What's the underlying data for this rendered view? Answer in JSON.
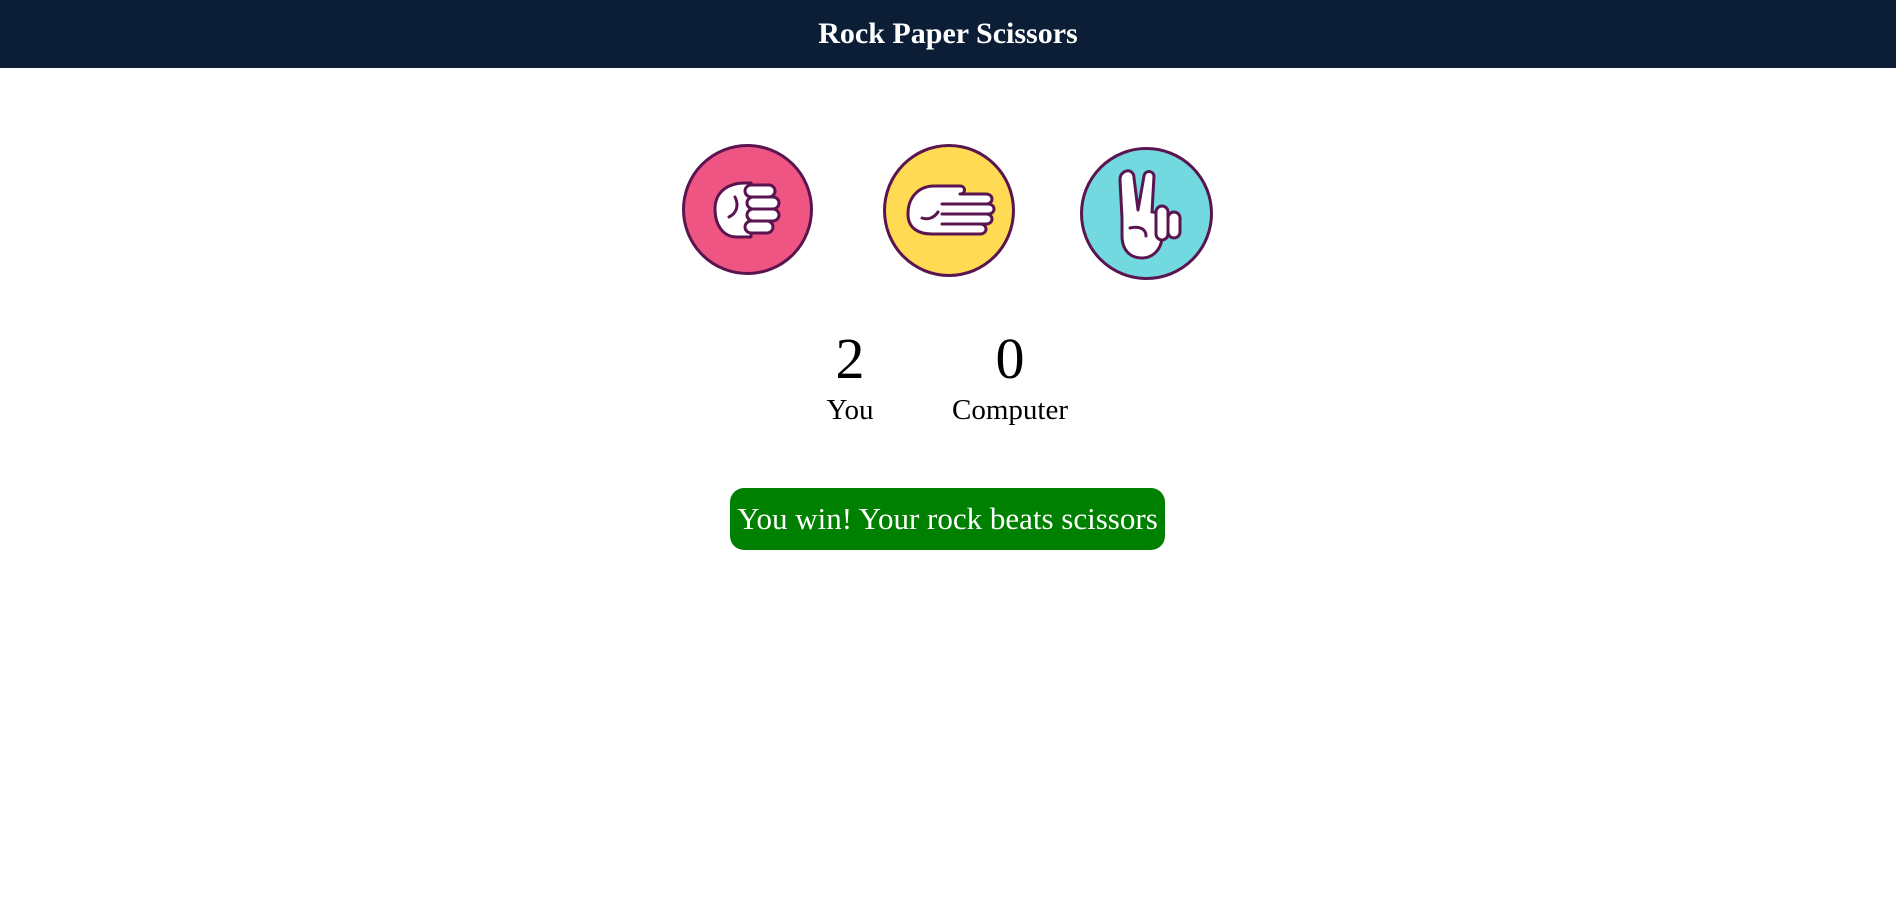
{
  "header": {
    "title": "Rock Paper Scissors"
  },
  "choices": [
    {
      "id": "rock",
      "icon": "rock-fist-icon",
      "color": "#ee5582"
    },
    {
      "id": "paper",
      "icon": "paper-hand-icon",
      "color": "#fedb52"
    },
    {
      "id": "scissors",
      "icon": "scissors-hand-icon",
      "color": "#72d9e0"
    }
  ],
  "scoreboard": {
    "you": {
      "score": "2",
      "label": "You"
    },
    "computer": {
      "score": "0",
      "label": "Computer"
    }
  },
  "result": {
    "message": "You win! Your rock beats scissors",
    "color": "#008000"
  },
  "colors": {
    "header_bg": "#0b1e36",
    "outline": "#5a1550"
  }
}
